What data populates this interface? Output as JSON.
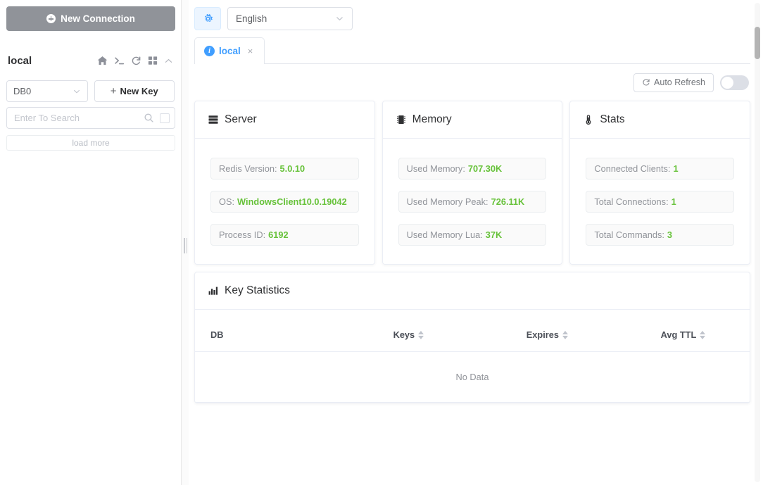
{
  "sidebar": {
    "new_connection_label": "New Connection",
    "connection_name": "local",
    "action_icons": [
      "home-icon",
      "console-icon",
      "refresh-icon",
      "grid-icon",
      "chevron-up-icon"
    ],
    "db_select_value": "DB0",
    "new_key_label": "New Key",
    "search_placeholder": "Enter To Search",
    "load_more_label": "load more"
  },
  "topbar": {
    "settings_icon": "gear-icon",
    "language_value": "English"
  },
  "tabs": [
    {
      "label": "local",
      "icon": "info-icon",
      "close": "×",
      "active": true
    }
  ],
  "toolbar": {
    "auto_refresh_label": "Auto Refresh",
    "auto_refresh_on": false
  },
  "cards": [
    {
      "title": "Server",
      "icon": "server-rack-icon",
      "items": [
        {
          "label": "Redis Version:",
          "value": "5.0.10"
        },
        {
          "label": "OS:",
          "value": "WindowsClient10.0.19042"
        },
        {
          "label": "Process ID:",
          "value": "6192"
        }
      ]
    },
    {
      "title": "Memory",
      "icon": "memory-chip-icon",
      "items": [
        {
          "label": "Used Memory:",
          "value": "707.30K"
        },
        {
          "label": "Used Memory Peak:",
          "value": "726.11K"
        },
        {
          "label": "Used Memory Lua:",
          "value": "37K"
        }
      ]
    },
    {
      "title": "Stats",
      "icon": "thermometer-icon",
      "items": [
        {
          "label": "Connected Clients:",
          "value": "1"
        },
        {
          "label": "Total Connections:",
          "value": "1"
        },
        {
          "label": "Total Commands:",
          "value": "3"
        }
      ]
    }
  ],
  "key_statistics": {
    "title": "Key Statistics",
    "icon": "bar-chart-icon",
    "columns": [
      {
        "label": "DB",
        "sortable": false
      },
      {
        "label": "Keys",
        "sortable": true
      },
      {
        "label": "Expires",
        "sortable": true
      },
      {
        "label": "Avg TTL",
        "sortable": true
      }
    ],
    "rows": [],
    "empty_text": "No Data"
  },
  "colors": {
    "accent_blue": "#409eff",
    "value_green": "#67c23a",
    "label_grey": "#909399",
    "button_grey": "#909399"
  }
}
